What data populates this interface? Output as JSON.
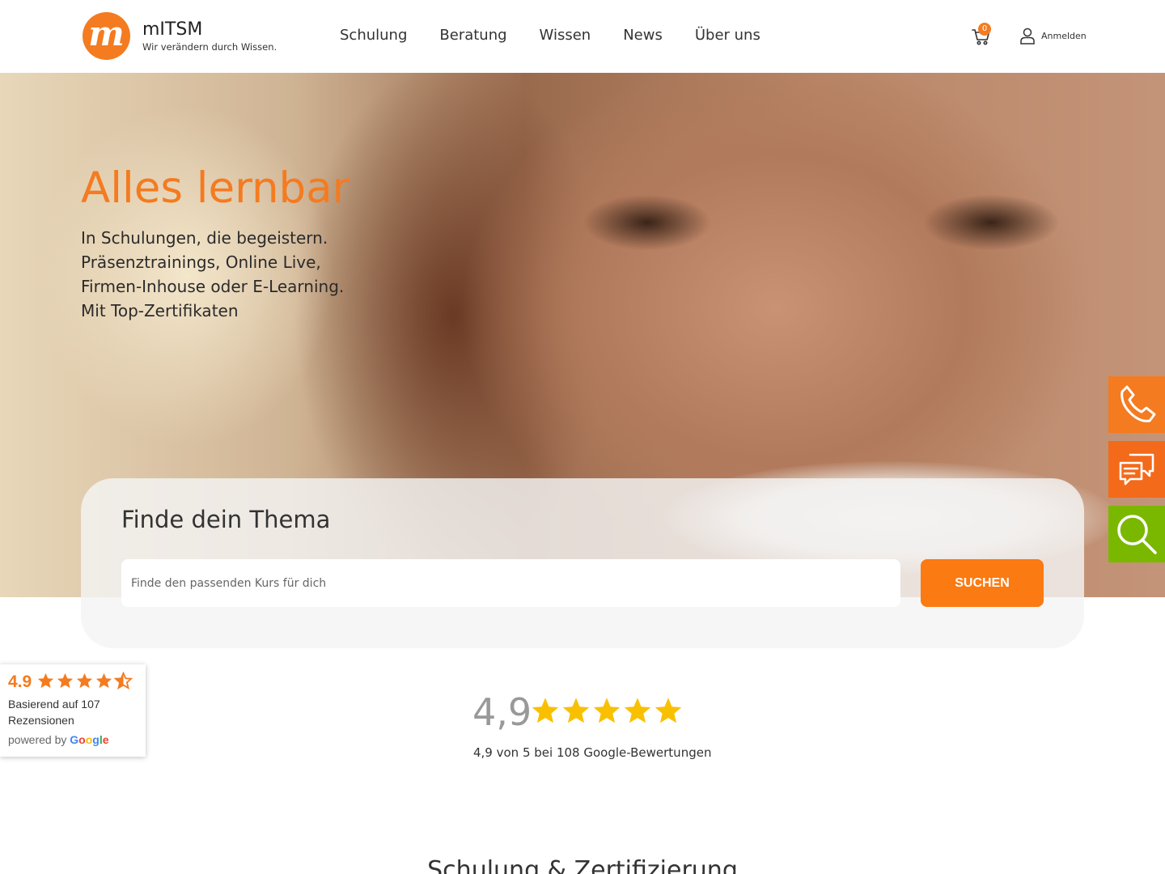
{
  "header": {
    "logo_letter": "m",
    "brand_name": "mITSM",
    "tagline": "Wir verändern durch Wissen.",
    "nav": [
      {
        "label": "Schulung"
      },
      {
        "label": "Beratung"
      },
      {
        "label": "Wissen"
      },
      {
        "label": "News"
      },
      {
        "label": "Über uns"
      }
    ],
    "cart_count": "0",
    "login_label": "Anmelden"
  },
  "hero": {
    "title": "Alles lernbar",
    "lines": [
      "In Schulungen, die begeistern.",
      "Präsenztrainings, Online Live,",
      "Firmen-Inhouse oder E-Learning.",
      "Mit Top-Zertifikaten"
    ]
  },
  "side_buttons": [
    {
      "icon": "phone-icon",
      "color": "#f47b20"
    },
    {
      "icon": "chat-icon",
      "color": "#f36a1a"
    },
    {
      "icon": "search-icon",
      "color": "#7ab800"
    }
  ],
  "search": {
    "title": "Finde dein Thema",
    "placeholder": "Finde den passenden Kurs für dich",
    "button_label": "SUCHEN"
  },
  "rating_widget": {
    "score": "4.9",
    "stars": 4.5,
    "text": "Basierend auf 107 Rezensionen",
    "powered_by": "powered by",
    "google": "Google"
  },
  "center_rating": {
    "score": "4,9",
    "stars": 5,
    "caption": "4,9 von 5 bei 108 Google-Bewertungen"
  },
  "section_heading": "Schulung & Zertifizierung",
  "colors": {
    "accent": "#f47b20",
    "search_button": "#fb7a12",
    "star_gold": "#f9c000",
    "green": "#7ab800"
  }
}
